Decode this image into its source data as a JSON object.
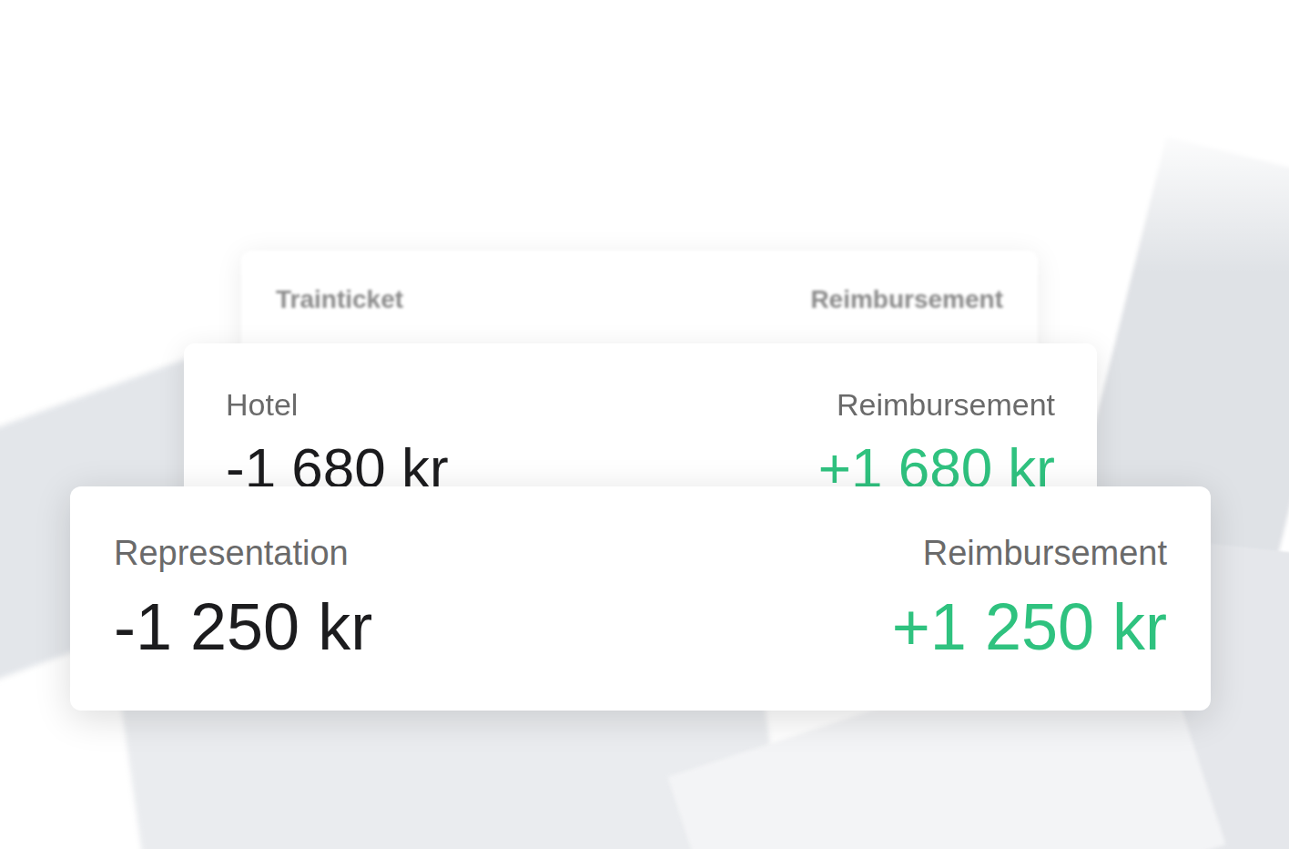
{
  "cards": [
    {
      "category": "Trainticket",
      "type": "Reimbursement"
    },
    {
      "category": "Hotel",
      "type": "Reimbursement",
      "expense": "-1 680 kr",
      "refund": "+1 680 kr"
    },
    {
      "category": "Representation",
      "type": "Reimbursement",
      "expense": "-1 250 kr",
      "refund": "+1 250 kr"
    }
  ]
}
